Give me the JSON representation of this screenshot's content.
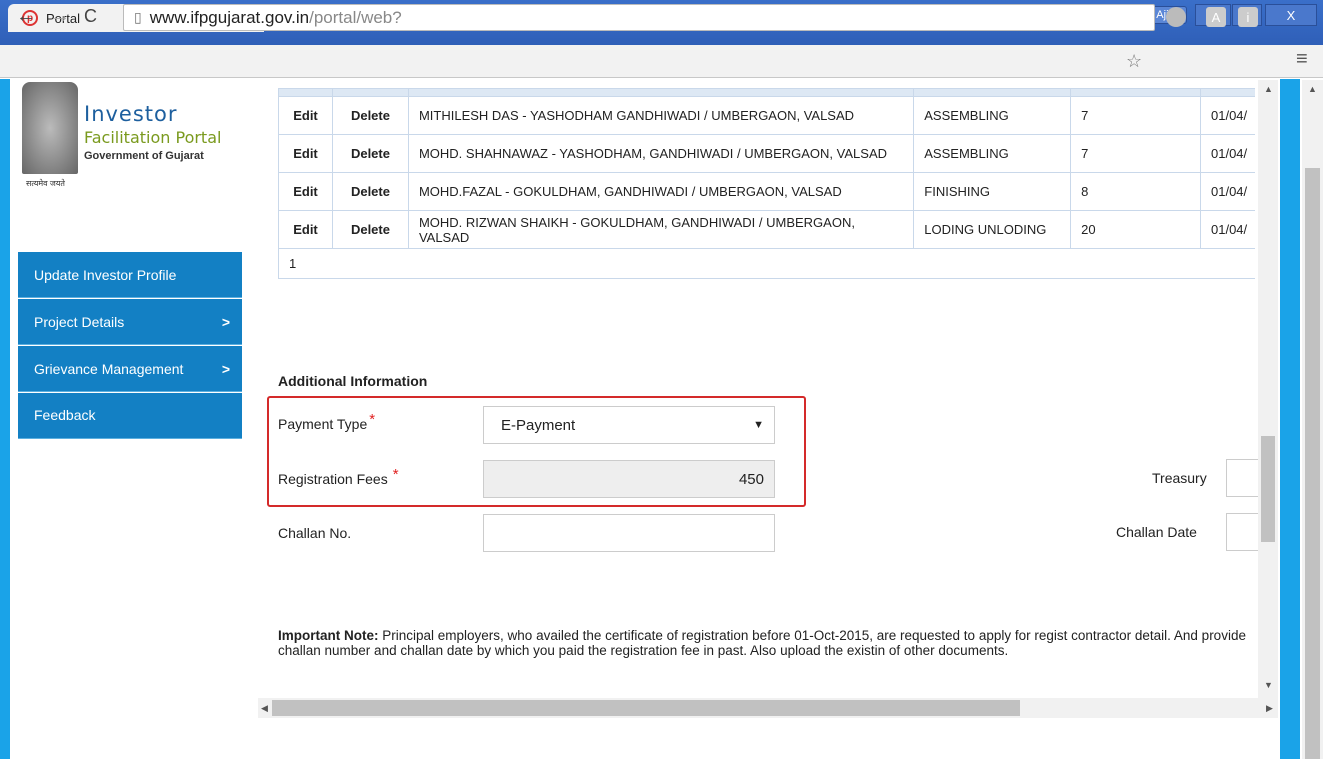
{
  "browser": {
    "tab_title": "Portal",
    "tab_close": "×",
    "user_name": "Ajit",
    "url_domain": "www.ifpgujarat.gov.in",
    "url_path": "/portal/web?",
    "win_minimize": "—",
    "win_restore": "⧉",
    "win_close": "X"
  },
  "logo": {
    "line1": "Investor",
    "line2": "Facilitation Portal",
    "line3": "Government of Gujarat",
    "motto": "सत्यमेव जयते"
  },
  "sidebar": {
    "items": [
      {
        "label": "Update Investor Profile",
        "chevron": ""
      },
      {
        "label": "Project Details",
        "chevron": ">"
      },
      {
        "label": "Grievance Management",
        "chevron": ">"
      },
      {
        "label": "Feedback",
        "chevron": ""
      }
    ]
  },
  "table": {
    "rows": [
      {
        "edit": "Edit",
        "delete": "Delete",
        "name": "MITHILESH DAS - YASHODHAM GANDHIWADI / UMBERGAON, VALSAD",
        "work": "ASSEMBLING",
        "count": "7",
        "date": "01/04/"
      },
      {
        "edit": "Edit",
        "delete": "Delete",
        "name": "MOHD. SHAHNAWAZ - YASHODHAM, GANDHIWADI / UMBERGAON, VALSAD",
        "work": "ASSEMBLING",
        "count": "7",
        "date": "01/04/"
      },
      {
        "edit": "Edit",
        "delete": "Delete",
        "name": "MOHD.FAZAL - GOKULDHAM, GANDHIWADI / UMBERGAON, VALSAD",
        "work": "FINISHING",
        "count": "8",
        "date": "01/04/"
      },
      {
        "edit": "Edit",
        "delete": "Delete",
        "name": "MOHD. RIZWAN SHAIKH - GOKULDHAM, GANDHIWADI / UMBERGAON, VALSAD",
        "work": "LODING UNLODING",
        "count": "20",
        "date": "01/04/"
      }
    ],
    "page": "1"
  },
  "form": {
    "section_title": "Additional Information",
    "payment_type_label": "Payment Type",
    "payment_type_value": "E-Payment",
    "registration_fees_label": "Registration Fees",
    "registration_fees_value": "450",
    "challan_no_label": "Challan No.",
    "treasury_label": "Treasury",
    "challan_date_label": "Challan Date",
    "required_mark": "*"
  },
  "note": {
    "title": "Important Note:",
    "text": " Principal employers, who availed the certificate of registration before 01-Oct-2015, are requested to apply for regist contractor detail. And provide challan number and challan date by which you paid the registration fee in past. Also upload the existin of other documents."
  },
  "colors": {
    "sidebar": "#1380c4",
    "highlight": "#d42a2a",
    "accent_bar": "#1aa3e8"
  }
}
